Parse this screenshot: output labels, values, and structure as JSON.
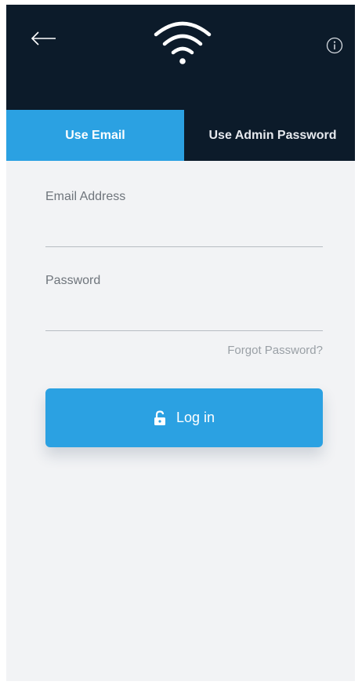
{
  "header": {
    "back_icon": "arrow-left-icon",
    "wifi_icon": "wifi-icon",
    "info_icon": "info-icon"
  },
  "tabs": [
    {
      "label": "Use Email",
      "active": true
    },
    {
      "label": "Use Admin Password",
      "active": false
    }
  ],
  "form": {
    "email_label": "Email Address",
    "email_value": "",
    "password_label": "Password",
    "password_value": "",
    "forgot_link": "Forgot Password?",
    "login_label": "Log in",
    "login_icon": "lock-icon"
  },
  "colors": {
    "header_bg": "#0c1b2a",
    "accent": "#2ba1e2",
    "body_bg": "#f2f3f5"
  }
}
